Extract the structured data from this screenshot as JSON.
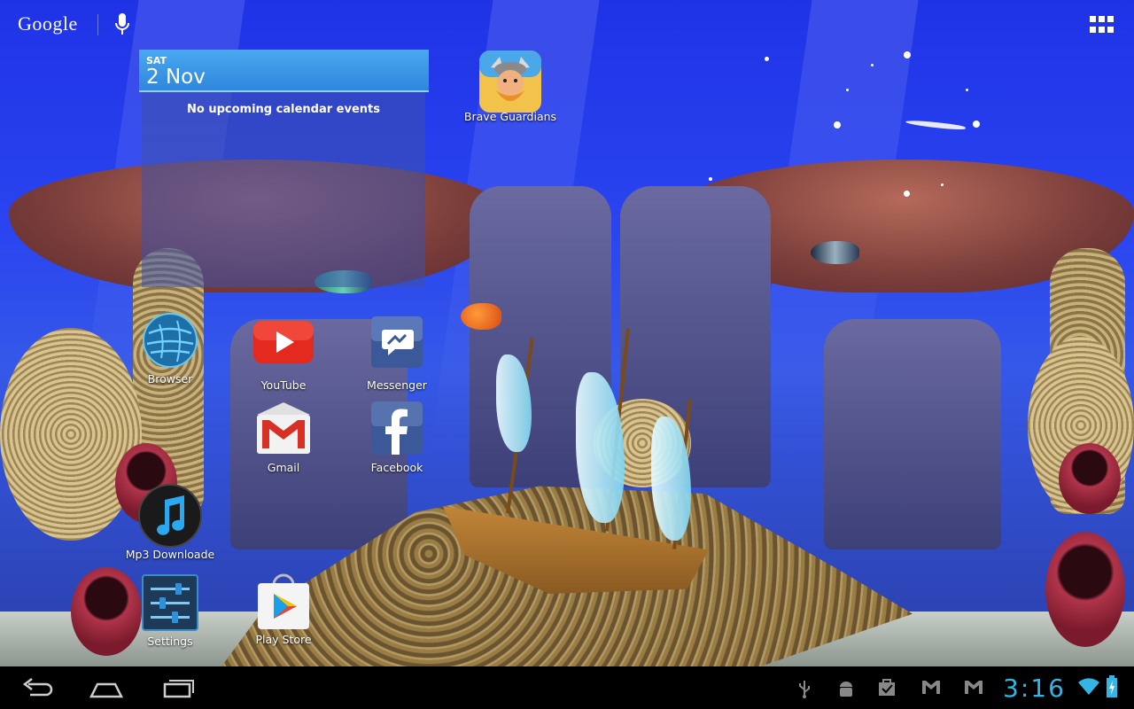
{
  "top_bar": {
    "search_brand": "Google"
  },
  "calendar_widget": {
    "day": "SAT",
    "date": "2 Nov",
    "empty_message": "No upcoming calendar events"
  },
  "apps": {
    "brave_guardians": "Brave Guardians",
    "browser": "Browser",
    "youtube": "YouTube",
    "messenger": "Messenger",
    "gmail": "Gmail",
    "facebook": "Facebook",
    "mp3_downloader": "Mp3 Downloade",
    "settings": "Settings",
    "play_store": "Play Store"
  },
  "status_bar": {
    "time": "3:16",
    "icons": [
      "usb-icon",
      "android-debug-icon",
      "tasks-icon",
      "gmail-notification-icon",
      "gmail-notification-icon",
      "wifi-icon",
      "battery-charging-icon"
    ]
  },
  "navigation": {
    "buttons": [
      "back-icon",
      "home-icon",
      "recent-apps-icon"
    ]
  },
  "colors": {
    "accent": "#33b5e5",
    "calendar_header": "#3a97e6",
    "navbar": "#000000"
  }
}
